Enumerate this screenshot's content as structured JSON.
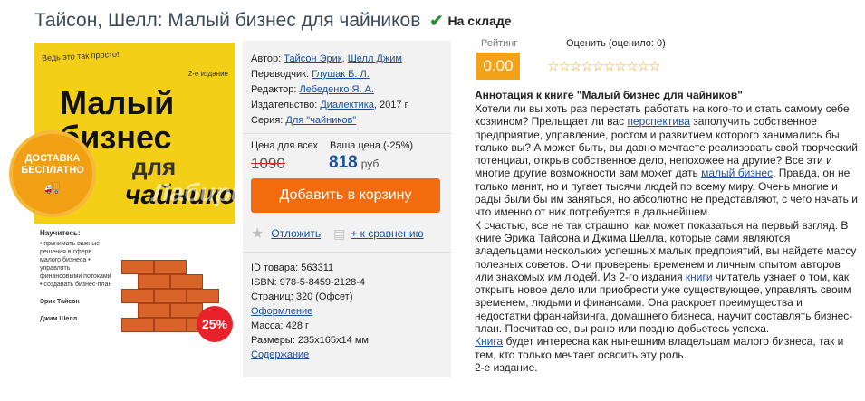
{
  "product": {
    "title": "Тайсон, Шелл: Малый бизнес для чайников",
    "stock_label": "На складе"
  },
  "cover": {
    "tagline": "Ведь это так просто!",
    "edition": "2-е издание",
    "title_line1": "Малый",
    "title_line2": "бизнес",
    "for_word": "для",
    "dummies_word": "чайников",
    "watermark": "Лабиринт.ру",
    "learn_heading": "Научитесь:",
    "learn_text": "• принимать важные решения в сфере малого бизнеса • управлять финансовыми потоками • создавать бизнес-план",
    "author1": "Эрик Тайсон",
    "author2": "Джим Шелл",
    "delivery_line1": "ДОСТАВКА",
    "delivery_line2": "БЕСПЛАТНО",
    "discount": "25%"
  },
  "meta": {
    "author_label": "Автор:",
    "author1": "Тайсон Эрик",
    "author2": "Шелл Джим",
    "translator_label": "Переводчик:",
    "translator": "Глушак Б. Л.",
    "editor_label": "Редактор:",
    "editor": "Лебеденко Я. А.",
    "publisher_label": "Издательство:",
    "publisher": "Диалектика",
    "year": ", 2017 г.",
    "series_label": "Серия:",
    "series": "Для \"чайников\""
  },
  "price": {
    "all_label": "Цена для всех",
    "your_label": "Ваша цена (-25%)",
    "old": "1090",
    "new": "818",
    "currency": "руб."
  },
  "actions": {
    "cart_button": "Добавить в корзину",
    "postpone": "Отложить",
    "compare": "+ к сравнению"
  },
  "details": {
    "id": "ID товара: 563311",
    "isbn": "ISBN: 978-5-8459-2128-4",
    "pages": "Страниц: 320 (Офсет)",
    "design": "Оформление",
    "weight": "Масса: 428 г",
    "size": "Размеры: 235x165x14 мм",
    "contents": "Содержание"
  },
  "rating": {
    "label": "Рейтинг",
    "value": "0.00",
    "rate_label": "Оценить (оценило: 0)",
    "stars": "☆☆☆☆☆☆☆☆☆☆"
  },
  "annotation": {
    "title": "Аннотация к книге \"Малый бизнес для чайников\"",
    "p1_a": "Хотели ли вы хоть раз перестать работать на кого-то и стать самому себе хозяином? Прельщает ли вас ",
    "p1_link1": "перспектива",
    "p1_b": " заполучить собственное предприятие, управление, ростом и развитием которого занимались бы только вы? А может быть, вы давно мечтаете реализовать свой творческий потенциал, открыв собственное дело, непохожее на другие? Все эти и многие другие возможности вам может дать ",
    "p1_link2": "малый бизнес",
    "p1_c": ". Правда, он не только манит, но и пугает тысячи людей по всему миру. Очень многие и рады были бы им заняться, но абсолютно не представляют, с чего начать и что именно от них потребуется в дальнейшем.",
    "p2_a": "К счастью, все не так страшно, как может показаться на первый взгляд. В книге Эрика Тайсона и Джима Шелла, которые сами являются владельцами нескольких успешных малых предприятий, вы найдете массу полезных советов. Они проверены временем и личным опытом авторов или знакомых им людей. Из 2-го издания ",
    "p2_link": "книги",
    "p2_b": " читатель узнает о том, как открыть новое дело или приобрести уже существующее, управлять своим временем, людьми и финансами. Она раскроет преимущества и недостатки франчайзинга, домашнего бизнеса, научит составлять бизнес-план. Прочитав ее, вы рано или поздно добьетесь успеха.",
    "p3_link": "Книга",
    "p3_b": " будет интересна как нынешним владельцам малого бизнеса, так и тем, кто только мечтает освоить эту роль.",
    "p4": "2-е издание."
  },
  "colors": {
    "accent_orange": "#f26b0c",
    "rating_orange": "#f3a31a",
    "link_blue": "#1a4f9c",
    "stock_green": "#2e8b35"
  }
}
